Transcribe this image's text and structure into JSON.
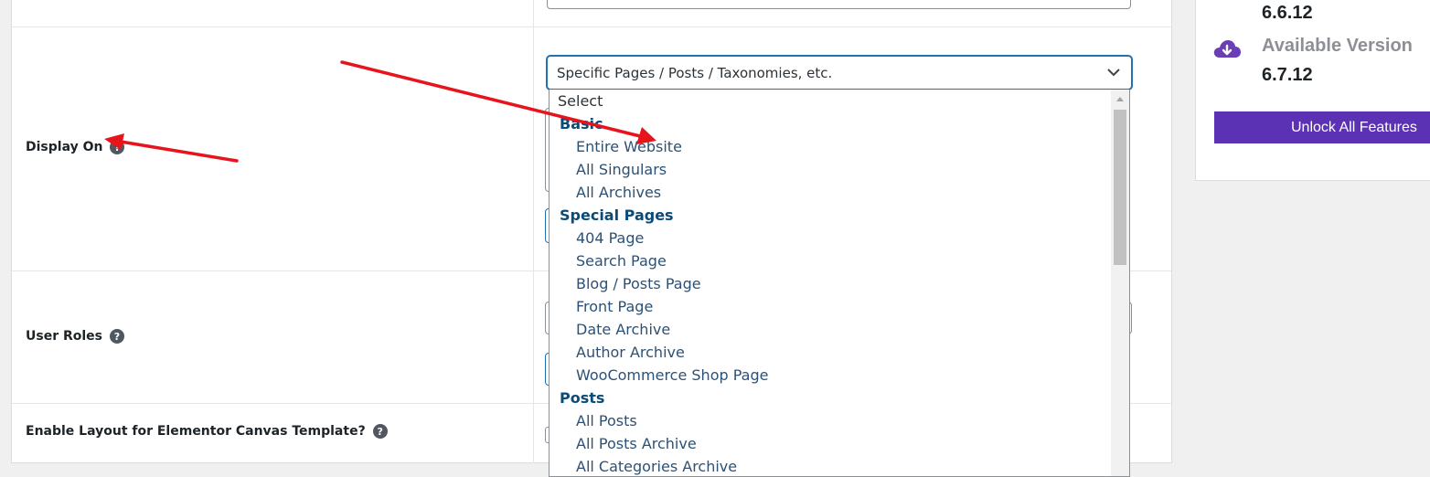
{
  "settings": {
    "display_on": {
      "label": "Display On",
      "help": "?",
      "selected_value": "Specific Pages / Posts / Taxonomies, etc."
    },
    "user_roles": {
      "label": "User Roles",
      "help": "?"
    },
    "elementor_canvas": {
      "label": "Enable Layout for Elementor Canvas Template?",
      "help": "?"
    }
  },
  "dropdown": {
    "placeholder": "Select",
    "groups": [
      {
        "label": "Basic",
        "options": [
          "Entire Website",
          "All Singulars",
          "All Archives"
        ]
      },
      {
        "label": "Special Pages",
        "options": [
          "404 Page",
          "Search Page",
          "Blog / Posts Page",
          "Front Page",
          "Date Archive",
          "Author Archive",
          "WooCommerce Shop Page"
        ]
      },
      {
        "label": "Posts",
        "options": [
          "All Posts",
          "All Posts Archive",
          "All Categories Archive"
        ]
      }
    ]
  },
  "sidebar": {
    "current_version": "6.6.12",
    "available_label": "Available Version",
    "available_version": "6.7.12",
    "unlock_button": "Unlock All Features"
  },
  "colors": {
    "accent": "#5b32b4",
    "focus": "#2271b1",
    "annotation_arrow": "#e8141c"
  }
}
